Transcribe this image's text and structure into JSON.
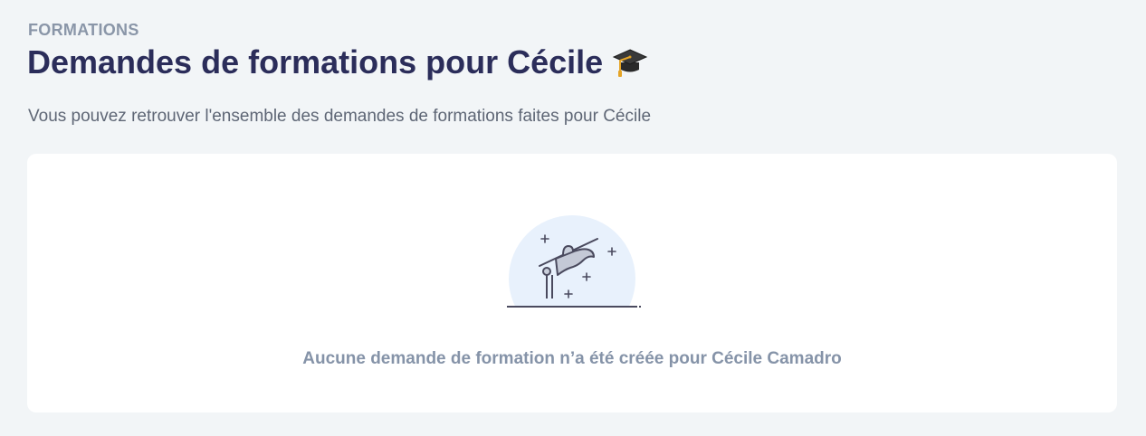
{
  "header": {
    "eyebrow": "FORMATIONS",
    "title": "Demandes de formations pour Cécile",
    "title_icon": "graduation-cap-icon",
    "subtitle": "Vous pouvez retrouver l'ensemble des demandes de formations faites pour Cécile"
  },
  "empty_state": {
    "illustration_icon": "graduation-cap-illustration-icon",
    "message": "Aucune demande de formation n’a été créée pour Cécile Camadro"
  },
  "colors": {
    "page_background": "#f2f5f7",
    "title": "#2b2d5a",
    "eyebrow": "#8a96a8",
    "muted_text": "#8593a8",
    "illustration_circle": "#e8f1fc"
  }
}
